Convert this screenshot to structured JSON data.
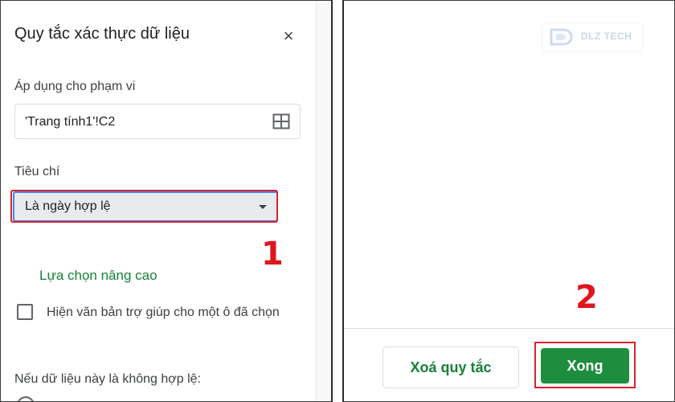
{
  "sidebar": {
    "title": "Quy tắc xác thực dữ liệu",
    "close_symbol": "×",
    "apply_to_range_label": "Áp dụng cho phạm vi",
    "range_value": "'Trang tính1'!C2",
    "criteria_label": "Tiêu chí",
    "criteria_value": "Là ngày hợp lệ",
    "advanced_options_link": "Lựa chọn nâng cao",
    "help_text_checkbox_label": "Hiện văn bản trợ giúp cho một ô đã chọn",
    "help_text_checked": false,
    "invalid_data_label": "Nếu dữ liệu này là không hợp lệ:"
  },
  "annotations": {
    "step_one": "1",
    "step_two": "2",
    "highlight_color": "#d6242b"
  },
  "watermark": {
    "text": "DLZ TECH"
  },
  "footer": {
    "remove_rule_label": "Xoá quy tắc",
    "done_label": "Xong"
  },
  "colors": {
    "accent_green": "#188038",
    "done_button": "#1e8e3e",
    "focus_blue": "#4285f4"
  },
  "icons": {
    "close": "close-icon",
    "select_range": "grid-icon",
    "dropdown": "caret-down-icon"
  }
}
